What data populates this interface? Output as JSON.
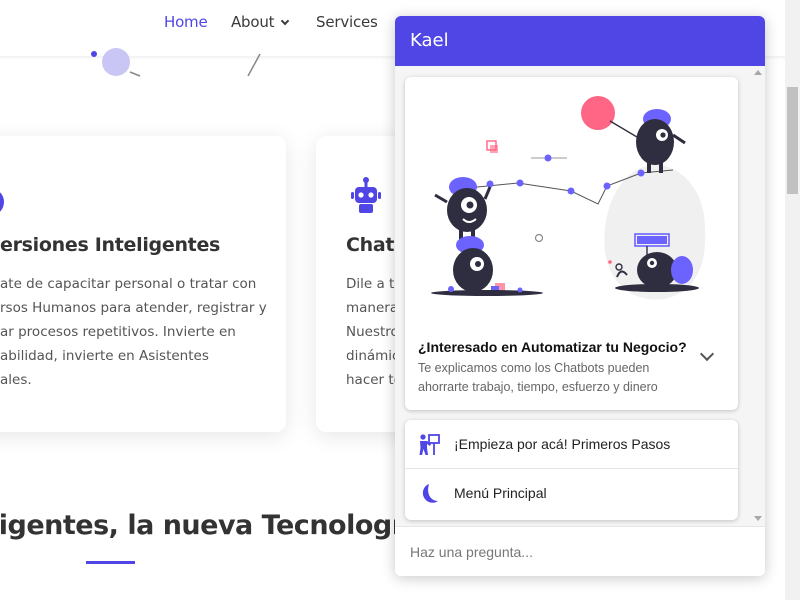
{
  "nav": {
    "home": "Home",
    "about": "About",
    "services": "Services"
  },
  "cards": [
    {
      "title": "ersiones Inteligentes",
      "text": "ate de capacitar personal o tratar con\nrsos Humanos para atender, registrar y\nar procesos repetitivos. Invierte en\nabilidad, invierte en Asistentes\nales."
    },
    {
      "title": "Chatb",
      "text": "Dile a to\nmanera\nNuestro\ndinámic\nhacer to"
    }
  ],
  "section": {
    "title": "ligentes, la nueva Tecnologí"
  },
  "chat": {
    "title": "Kael",
    "hero": {
      "heading": "¿Interesado en Automatizar tu Negocio?",
      "subtext": "Te explicamos como los Chatbots pueden ahorrarte trabajo, tiempo, esfuerzo y dinero"
    },
    "menu": [
      {
        "label": "¡Empieza por acá! Primeros Pasos",
        "icon": "presenter-board-icon"
      },
      {
        "label": "Menú Principal",
        "icon": "moon-icon"
      }
    ],
    "input_placeholder": "Haz una pregunta..."
  },
  "colors": {
    "accent": "#4f46e5",
    "illustration_dark": "#2f2e41",
    "illustration_pink": "#ff6584"
  }
}
